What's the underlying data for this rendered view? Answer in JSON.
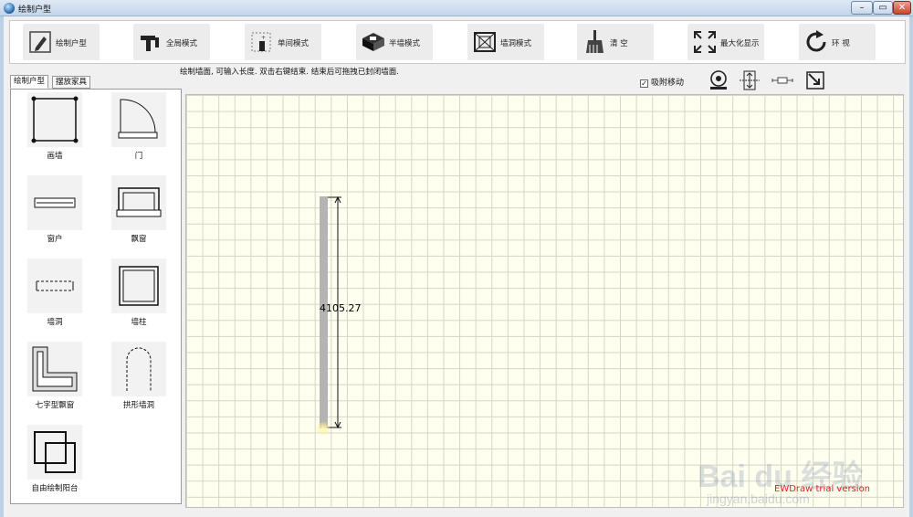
{
  "window": {
    "title": "绘制户型",
    "min_label": "–",
    "max_label": "▭",
    "close_label": "✕"
  },
  "toolbar": [
    {
      "label": "绘制户型",
      "icon": "pencil-icon"
    },
    {
      "label": "全局模式",
      "icon": "global-layout-icon"
    },
    {
      "label": "单间模式",
      "icon": "single-room-icon"
    },
    {
      "label": "半墙模式",
      "icon": "half-wall-icon"
    },
    {
      "label": "墙洞模式",
      "icon": "wall-hole-icon"
    },
    {
      "label": "清 空",
      "icon": "broom-icon"
    },
    {
      "label": "最大化显示",
      "icon": "maximize-icon"
    },
    {
      "label": "环 视",
      "icon": "rotate-icon"
    }
  ],
  "hint": "绘制墙面, 可输入长度. 双击右键结束.  结束后可拖拽已封闭墙面.",
  "snap": {
    "label": "吸附移动",
    "checked": true,
    "check_mark": "✓"
  },
  "tabs": [
    {
      "label": "绘制户型",
      "active": true
    },
    {
      "label": "摆放家具",
      "active": false
    }
  ],
  "palette": [
    {
      "label": "画墙",
      "icon": "draw-wall-icon"
    },
    {
      "label": "门",
      "icon": "door-icon"
    },
    {
      "label": "窗户",
      "icon": "window-icon"
    },
    {
      "label": "飘窗",
      "icon": "bay-window-icon"
    },
    {
      "label": "墙洞",
      "icon": "wall-hole-icon"
    },
    {
      "label": "墙柱",
      "icon": "wall-pillar-icon"
    },
    {
      "label": "七字型飘窗",
      "icon": "l-bay-window-icon"
    },
    {
      "label": "拱形墙洞",
      "icon": "arch-hole-icon"
    },
    {
      "label": "自由绘制阳台",
      "icon": "free-balcony-icon"
    }
  ],
  "canvas": {
    "dimension_text": "4105.27",
    "trial_text": "EWDraw trial version"
  },
  "watermark": {
    "main": "Bai du 经验",
    "sub": "jingyan.baidu.com"
  }
}
